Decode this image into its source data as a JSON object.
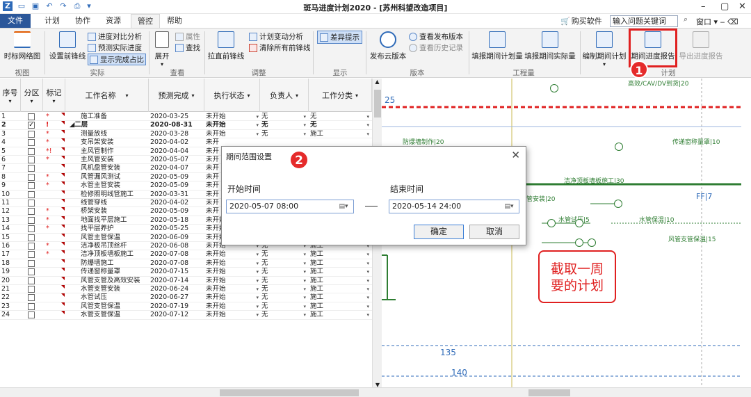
{
  "app": {
    "title": "斑马进度计划2020 - [苏州科望改造项目]",
    "window_menu": "窗口",
    "buy_label": "购买软件",
    "help_placeholder": "输入问题关键词"
  },
  "menu_tabs": [
    "文件",
    "计划",
    "协作",
    "资源",
    "管控",
    "帮助"
  ],
  "ribbon": {
    "view": {
      "network": "时标网络图",
      "label": "视图"
    },
    "actual": {
      "set_frontline": "设置前锋线",
      "compare": "进度对比分析",
      "predict": "预测实际进度",
      "show_percent": "显示完成占比",
      "label": "实际"
    },
    "check": {
      "expand": "展开",
      "property": "属性",
      "find": "查找",
      "label": "查看"
    },
    "adjust": {
      "straighten": "拉直前锋线",
      "change_analysis": "计划变动分析",
      "clear_frontlines": "清除所有前锋线",
      "label": "调整"
    },
    "display": {
      "diff_hint": "差异提示",
      "label": "显示"
    },
    "version": {
      "publish_cloud": "发布云版本",
      "view_published": "查看发布版本",
      "view_history": "查看历史记录",
      "label": "版本"
    },
    "work_qty": {
      "fill_plan_qty": "填报期间计划量",
      "fill_actual_qty": "填报期间实际量",
      "label": "工程量"
    },
    "plan": {
      "make_period_plan": "编制期间计划",
      "period_report": "期间进度报告",
      "export_report": "导出进度报告",
      "label": "计划"
    }
  },
  "callouts": [
    "1",
    "2"
  ],
  "grid": {
    "headers": [
      "序号",
      "分区",
      "标记",
      "工作名称",
      "预测完成",
      "执行状态",
      "负责人",
      "工作分类"
    ],
    "rows": [
      {
        "no": "1",
        "checked": false,
        "mark": "*",
        "name": "施工准备",
        "finish": "2020-03-25",
        "status": "未开始",
        "owner": "无",
        "cat": "无",
        "bold": false
      },
      {
        "no": "2",
        "checked": true,
        "mark": "!",
        "name": "◢二层",
        "finish": "2020-08-31",
        "status": "未开始",
        "owner": "无",
        "cat": "无",
        "bold": true
      },
      {
        "no": "3",
        "checked": false,
        "mark": "*",
        "name": "测量放线",
        "finish": "2020-03-28",
        "status": "未开始",
        "owner": "无",
        "cat": "施工",
        "bold": false
      },
      {
        "no": "4",
        "checked": false,
        "mark": "*",
        "name": "支吊架安装",
        "finish": "2020-04-02",
        "status": "未开",
        "owner": "",
        "cat": "",
        "bold": false
      },
      {
        "no": "5",
        "checked": false,
        "mark": "*!",
        "name": "主风管制作",
        "finish": "2020-04-04",
        "status": "未开",
        "owner": "",
        "cat": "",
        "bold": false
      },
      {
        "no": "6",
        "checked": false,
        "mark": "*",
        "name": "主风管安装",
        "finish": "2020-05-07",
        "status": "未开",
        "owner": "",
        "cat": "",
        "bold": false
      },
      {
        "no": "7",
        "checked": false,
        "mark": "",
        "name": "风机盘管安装",
        "finish": "2020-04-07",
        "status": "未开",
        "owner": "",
        "cat": "",
        "bold": false
      },
      {
        "no": "8",
        "checked": false,
        "mark": "*",
        "name": "风管漏风测试",
        "finish": "2020-05-09",
        "status": "未开",
        "owner": "",
        "cat": "",
        "bold": false
      },
      {
        "no": "9",
        "checked": false,
        "mark": "*",
        "name": "水管主管安装",
        "finish": "2020-05-09",
        "status": "未开",
        "owner": "",
        "cat": "",
        "bold": false
      },
      {
        "no": "10",
        "checked": false,
        "mark": "",
        "name": "检修照明线管施工",
        "finish": "2020-03-31",
        "status": "未开",
        "owner": "",
        "cat": "",
        "bold": false
      },
      {
        "no": "11",
        "checked": false,
        "mark": "",
        "name": "线管穿线",
        "finish": "2020-04-02",
        "status": "未开",
        "owner": "",
        "cat": "",
        "bold": false
      },
      {
        "no": "12",
        "checked": false,
        "mark": "*",
        "name": "桥架安装",
        "finish": "2020-05-09",
        "status": "未开",
        "owner": "",
        "cat": "",
        "bold": false
      },
      {
        "no": "13",
        "checked": false,
        "mark": "*",
        "name": "地面找平层施工",
        "finish": "2020-05-18",
        "status": "未开始",
        "owner": "无",
        "cat": "施工",
        "bold": false
      },
      {
        "no": "14",
        "checked": false,
        "mark": "*",
        "name": "找平层养护",
        "finish": "2020-05-25",
        "status": "未开始",
        "owner": "无",
        "cat": "施工",
        "bold": false
      },
      {
        "no": "15",
        "checked": false,
        "mark": "",
        "name": "风管主管保温",
        "finish": "2020-06-09",
        "status": "未开始",
        "owner": "无",
        "cat": "施工",
        "bold": false
      },
      {
        "no": "16",
        "checked": false,
        "mark": "*",
        "name": "洁净板吊顶丝杆",
        "finish": "2020-06-08",
        "status": "未开始",
        "owner": "无",
        "cat": "施工",
        "bold": false
      },
      {
        "no": "17",
        "checked": false,
        "mark": "*",
        "name": "洁净顶板墙板施工",
        "finish": "2020-07-08",
        "status": "未开始",
        "owner": "无",
        "cat": "施工",
        "bold": false
      },
      {
        "no": "18",
        "checked": false,
        "mark": "",
        "name": "防爆墙施工",
        "finish": "2020-07-08",
        "status": "未开始",
        "owner": "无",
        "cat": "施工",
        "bold": false
      },
      {
        "no": "19",
        "checked": false,
        "mark": "",
        "name": "传递窗称量罩",
        "finish": "2020-07-15",
        "status": "未开始",
        "owner": "无",
        "cat": "施工",
        "bold": false
      },
      {
        "no": "20",
        "checked": false,
        "mark": "",
        "name": "风管支管及高效安装",
        "finish": "2020-07-14",
        "status": "未开始",
        "owner": "无",
        "cat": "施工",
        "bold": false
      },
      {
        "no": "21",
        "checked": false,
        "mark": "",
        "name": "水管支管安装",
        "finish": "2020-06-24",
        "status": "未开始",
        "owner": "无",
        "cat": "施工",
        "bold": false
      },
      {
        "no": "22",
        "checked": false,
        "mark": "",
        "name": "水管试压",
        "finish": "2020-06-27",
        "status": "未开始",
        "owner": "无",
        "cat": "施工",
        "bold": false
      },
      {
        "no": "23",
        "checked": false,
        "mark": "",
        "name": "风管支管保温",
        "finish": "2020-07-19",
        "status": "未开始",
        "owner": "无",
        "cat": "施工",
        "bold": false
      },
      {
        "no": "24",
        "checked": false,
        "mark": "",
        "name": "水管支管保温",
        "finish": "2020-07-12",
        "status": "未开始",
        "owner": "无",
        "cat": "施工",
        "bold": false
      }
    ]
  },
  "gantt": {
    "labels": [
      {
        "text": "25"
      },
      {
        "text": "防爆墙制作|20"
      },
      {
        "text": "传递窗称量罩|10"
      },
      {
        "text": "洁净顶板墙板施工|30"
      },
      {
        "text": "管安装|20"
      },
      {
        "text": "FF|7"
      },
      {
        "text": "水管试压|5"
      },
      {
        "text": "水管保温|10"
      },
      {
        "text": "风管支管保温|15"
      },
      {
        "text": "高效/CAV/DV到货|20"
      },
      {
        "text": "135"
      },
      {
        "text": "140"
      }
    ]
  },
  "dialog": {
    "title": "期间范围设置",
    "start_label": "开始时间",
    "end_label": "结束时间",
    "start_value": "2020-05-07 08:00",
    "end_value": "2020-05-14 24:00",
    "ok": "确定",
    "cancel": "取消"
  },
  "annotation": {
    "line1": "截取一周",
    "line2": "要的计划"
  },
  "colors": {
    "file_tab": "#2b579a",
    "highlight": "#e02020",
    "gantt_green": "#2e7d32",
    "dashed_red": "#e02020"
  }
}
